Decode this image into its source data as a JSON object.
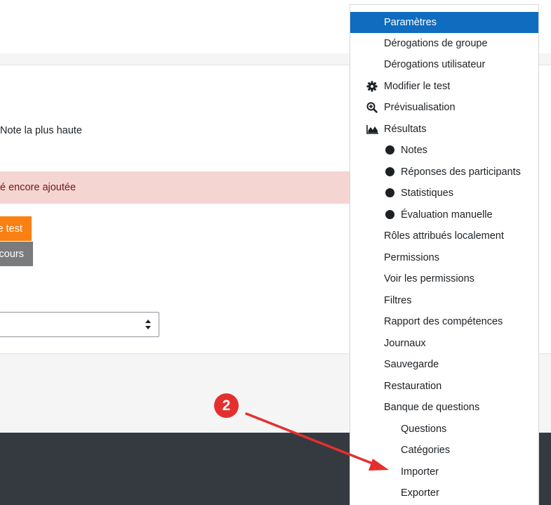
{
  "main": {
    "grade_method": "Note la plus haute",
    "alert_text": "é encore ajoutée",
    "primary_button": "e test",
    "secondary_button": "cours",
    "select_value": ""
  },
  "menu": {
    "items": [
      {
        "label": "Paramètres",
        "active": true
      },
      {
        "label": "Dérogations de groupe"
      },
      {
        "label": "Dérogations utilisateur"
      },
      {
        "label": "Modifier le test",
        "icon": "gear-icon"
      },
      {
        "label": "Prévisualisation",
        "icon": "zoom-in-icon"
      },
      {
        "label": "Résultats",
        "icon": "area-chart-icon"
      },
      {
        "label": "Notes",
        "icon": "bullet-icon"
      },
      {
        "label": "Réponses des participants",
        "icon": "bullet-icon"
      },
      {
        "label": "Statistiques",
        "icon": "bullet-icon"
      },
      {
        "label": "Évaluation manuelle",
        "icon": "bullet-icon"
      },
      {
        "label": "Rôles attribués localement"
      },
      {
        "label": "Permissions"
      },
      {
        "label": "Voir les permissions"
      },
      {
        "label": "Filtres"
      },
      {
        "label": "Rapport des compétences"
      },
      {
        "label": "Journaux"
      },
      {
        "label": "Sauvegarde"
      },
      {
        "label": "Restauration"
      },
      {
        "label": "Banque de questions"
      },
      {
        "label": "Questions"
      },
      {
        "label": "Catégories"
      },
      {
        "label": "Importer"
      },
      {
        "label": "Exporter"
      }
    ]
  },
  "annotation": {
    "step_number": "2",
    "color": "#e52f2f"
  },
  "colors": {
    "menu_active_bg": "#0f6cbf",
    "alert_bg": "#f5d5d2",
    "primary_button_bg": "#f98012",
    "secondary_button_bg": "#7a7b7d",
    "footer_bg": "#353a40"
  }
}
